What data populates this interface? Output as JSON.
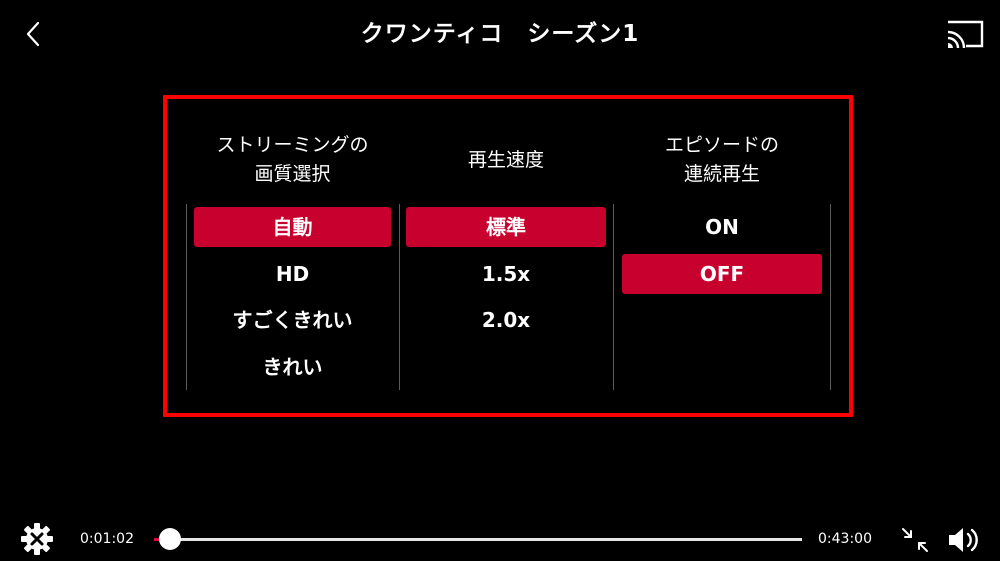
{
  "header": {
    "title": "クワンティコ　シーズン1",
    "back_icon": "chevron-left-icon",
    "cast_icon": "cast-icon"
  },
  "settings": {
    "border_color": "#ff0000",
    "selected_color": "#c8002d",
    "quality": {
      "header": "ストリーミングの\n画質選択",
      "options": [
        {
          "label": "自動",
          "selected": true
        },
        {
          "label": "HD",
          "selected": false
        },
        {
          "label": "すごくきれい",
          "selected": false
        },
        {
          "label": "きれい",
          "selected": false
        }
      ]
    },
    "speed": {
      "header": "再生速度",
      "options": [
        {
          "label": "標準",
          "selected": true
        },
        {
          "label": "1.5x",
          "selected": false
        },
        {
          "label": "2.0x",
          "selected": false
        }
      ]
    },
    "autoplay": {
      "header": "エピソードの\n連続再生",
      "options": [
        {
          "label": "ON",
          "selected": false
        },
        {
          "label": "OFF",
          "selected": true
        }
      ]
    }
  },
  "player": {
    "current_time": "0:01:02",
    "total_time": "0:43:00",
    "progress": 0.024,
    "played_color": "#e8003a",
    "settings_icon": "gear-close-icon",
    "exit_fullscreen_icon": "exit-fullscreen-icon",
    "volume_icon": "speaker-icon"
  }
}
